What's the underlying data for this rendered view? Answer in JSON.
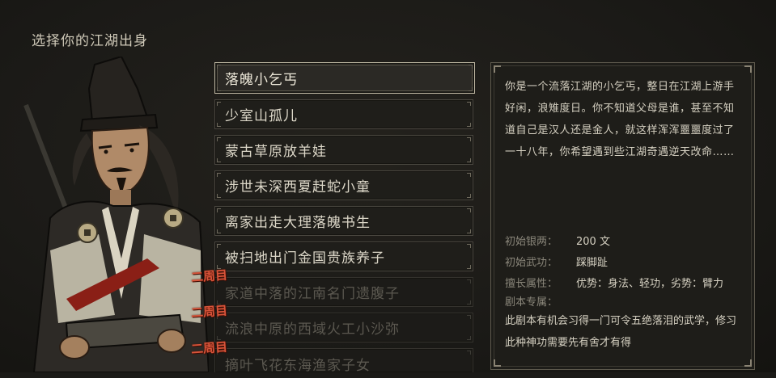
{
  "header": {
    "title": "选择你的江湖出身"
  },
  "options": [
    {
      "label": "落魄小乞丐",
      "state": "selected"
    },
    {
      "label": "少室山孤儿",
      "state": "normal"
    },
    {
      "label": "蒙古草原放羊娃",
      "state": "normal"
    },
    {
      "label": "涉世未深西夏赶蛇小童",
      "state": "normal"
    },
    {
      "label": "离家出走大理落魄书生",
      "state": "normal"
    },
    {
      "label": "被扫地出门金国贵族养子",
      "state": "normal"
    },
    {
      "label": "家道中落的江南名门遗腹子",
      "state": "locked",
      "badge": "二周目"
    },
    {
      "label": "流浪中原的西域火工小沙弥",
      "state": "locked",
      "badge": "二周目"
    },
    {
      "label": "摘叶飞花东海渔家子女",
      "state": "locked",
      "badge": "二周目"
    }
  ],
  "description": {
    "text": "你是一个流落江湖的小乞丐，整日在江湖上游手好闲，浪雉度日。你不知道父母是谁，甚至不知道自己是汉人还是金人，就这样浑浑噩噩度过了一十八年，你希望遇到些江湖奇遇逆天改命……",
    "stats": [
      {
        "label": "初始银两：",
        "value": "200 文"
      },
      {
        "label": "初始武功：",
        "value": "踩脚趾"
      },
      {
        "label": "擅长属性：",
        "value": "优势：身法、轻功，劣势：臂力"
      }
    ],
    "special_label": "剧本专属：",
    "special_text": "此剧本有机会习得一门可令五绝落泪的武学，修习此种神功需要先有舍才有得"
  },
  "colors": {
    "background": "#1b1a17",
    "badge_red": "#d8543a",
    "selected_border": "#bdb6a1",
    "locked_text": "#5b5850"
  }
}
